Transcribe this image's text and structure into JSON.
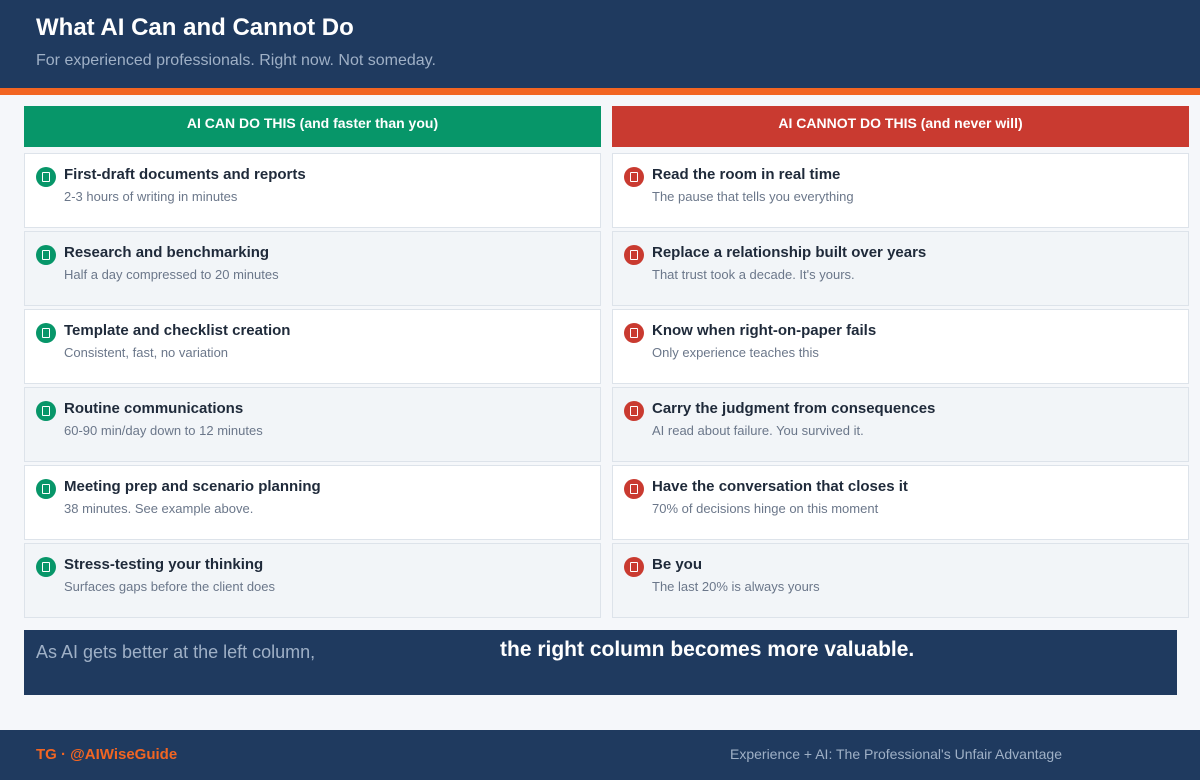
{
  "header": {
    "title": "What AI Can and Cannot Do",
    "subtitle": "For experienced professionals. Right now. Not someday."
  },
  "colors": {
    "navy": "#1f3a5f",
    "accent": "#f26522",
    "green": "#079669",
    "red": "#c93a30"
  },
  "left": {
    "heading": "AI CAN DO THIS  (and faster than you)",
    "icon": "document-icon",
    "items": [
      {
        "title": "First-draft documents and reports",
        "desc": "2-3 hours of writing in minutes"
      },
      {
        "title": "Research and benchmarking",
        "desc": "Half a day compressed to 20 minutes"
      },
      {
        "title": "Template and checklist creation",
        "desc": "Consistent, fast, no variation"
      },
      {
        "title": "Routine communications",
        "desc": "60-90 min/day down to 12 minutes"
      },
      {
        "title": "Meeting prep and scenario planning",
        "desc": "38 minutes. See example above."
      },
      {
        "title": "Stress-testing your thinking",
        "desc": "Surfaces gaps before the client does"
      }
    ]
  },
  "right": {
    "heading": "AI CANNOT DO THIS  (and never will)",
    "icon": "document-icon",
    "items": [
      {
        "title": "Read the room in real time",
        "desc": "The pause that tells you everything"
      },
      {
        "title": "Replace a relationship built over years",
        "desc": "That trust took a decade. It's yours."
      },
      {
        "title": "Know when right-on-paper fails",
        "desc": "Only experience teaches this"
      },
      {
        "title": "Carry the judgment from consequences",
        "desc": "AI read about failure. You survived it."
      },
      {
        "title": "Have the conversation that closes it",
        "desc": "70% of decisions hinge on this moment"
      },
      {
        "title": "Be you",
        "desc": "The last 20% is always yours"
      }
    ]
  },
  "banner": {
    "left": "As AI gets better at the left column,",
    "right": "the right column becomes more valuable."
  },
  "footer": {
    "brand": "TG  ·  @AIWiseGuide",
    "tagline": "Experience + AI: The Professional's Unfair Advantage"
  }
}
